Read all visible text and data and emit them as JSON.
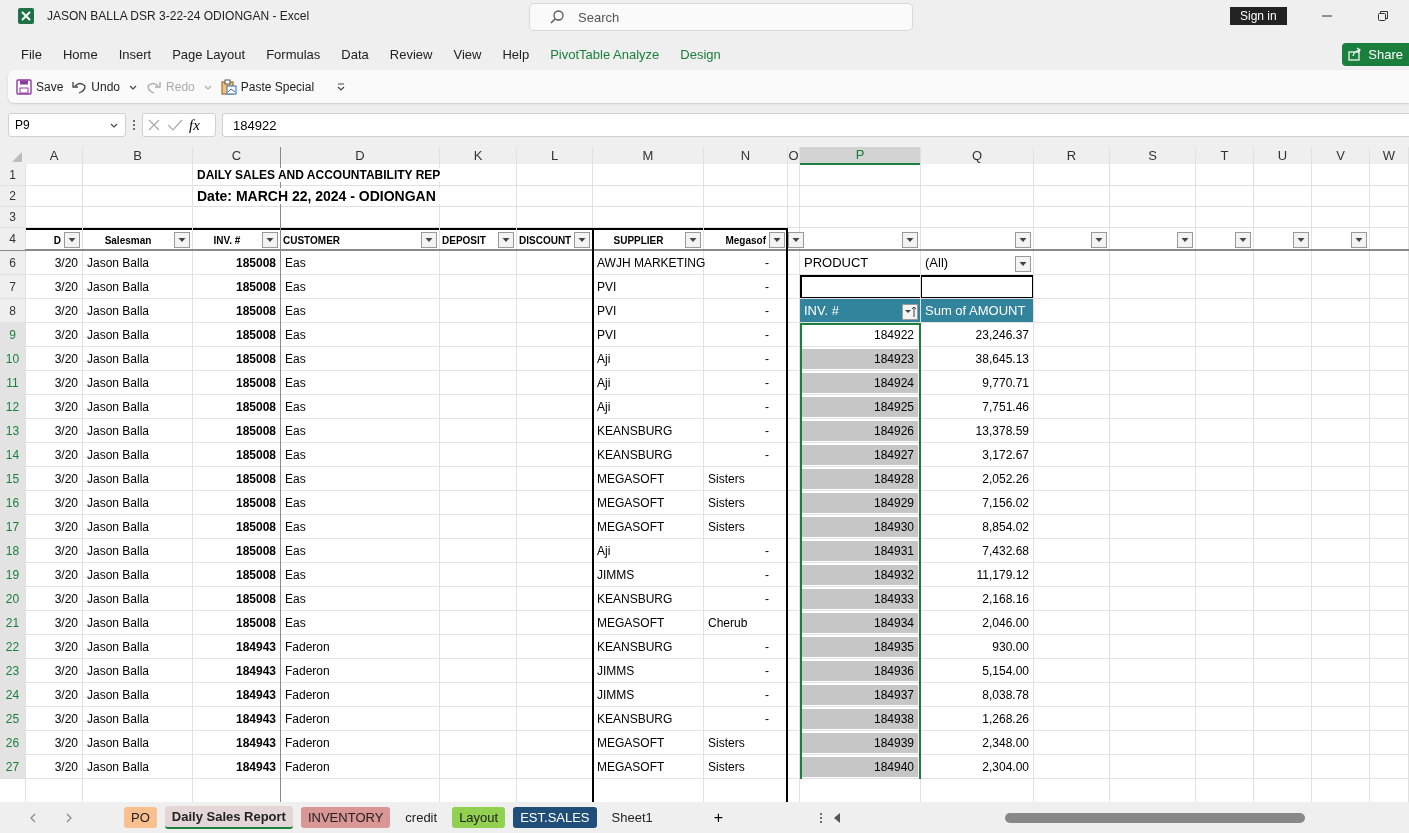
{
  "window": {
    "title": "JASON BALLA DSR 3-22-24 ODIONGAN  -  Excel",
    "search": {
      "placeholder": "Search"
    },
    "sign_in": "Sign in"
  },
  "menu": [
    {
      "label": "File",
      "kind": "standard"
    },
    {
      "label": "Home",
      "kind": "standard"
    },
    {
      "label": "Insert",
      "kind": "standard"
    },
    {
      "label": "Page Layout",
      "kind": "standard"
    },
    {
      "label": "Formulas",
      "kind": "standard"
    },
    {
      "label": "Data",
      "kind": "standard"
    },
    {
      "label": "Review",
      "kind": "standard"
    },
    {
      "label": "View",
      "kind": "standard"
    },
    {
      "label": "Help",
      "kind": "standard"
    },
    {
      "label": "PivotTable Analyze",
      "kind": "contextual"
    },
    {
      "label": "Design",
      "kind": "contextual"
    }
  ],
  "share": "Share",
  "quick_access": [
    {
      "label": "Save",
      "kind": "save",
      "disabled": false,
      "dropdown": false
    },
    {
      "label": "Undo",
      "kind": "undo",
      "disabled": false,
      "dropdown": true
    },
    {
      "label": "Redo",
      "kind": "redo",
      "disabled": true,
      "dropdown": true
    },
    {
      "label": "Paste Special",
      "kind": "paste",
      "disabled": false,
      "dropdown": false
    }
  ],
  "formula_bar": {
    "name_box": "P9",
    "fx": "fx",
    "value": "184922"
  },
  "sheet": {
    "columns": [
      {
        "letter": "A",
        "selected": false
      },
      {
        "letter": "B",
        "selected": false
      },
      {
        "letter": "C",
        "selected": false
      },
      {
        "letter": "D",
        "selected": false
      },
      {
        "letter": "K",
        "selected": false
      },
      {
        "letter": "L",
        "selected": false
      },
      {
        "letter": "M",
        "selected": false
      },
      {
        "letter": "N",
        "selected": false
      },
      {
        "letter": "O",
        "selected": false
      },
      {
        "letter": "P",
        "selected": true
      },
      {
        "letter": "Q",
        "selected": false
      },
      {
        "letter": "R",
        "selected": false
      },
      {
        "letter": "S",
        "selected": false
      },
      {
        "letter": "T",
        "selected": false
      },
      {
        "letter": "U",
        "selected": false
      },
      {
        "letter": "V",
        "selected": false
      },
      {
        "letter": "W",
        "selected": false
      }
    ],
    "rows": [
      {
        "number": "1",
        "kind": "title",
        "text": "DAILY SALES AND ACCOUNTABILITY REP"
      },
      {
        "number": "2",
        "kind": "subtitle",
        "text": "Date: MARCH 22, 2024 - ODIONGAN"
      },
      {
        "number": "3",
        "kind": "blank"
      },
      {
        "number": "4",
        "kind": "header",
        "headers": [
          {
            "label": "D",
            "filter": true
          },
          {
            "label": "Salesman",
            "filter": true
          },
          {
            "label": "INV. #",
            "filter": true
          },
          {
            "label": "CUSTOMER",
            "filter": true
          },
          {
            "label": "DEPOSIT",
            "filter": true
          },
          {
            "label": "DISCOUNT",
            "filter": true
          },
          {
            "label": "SUPPLIER",
            "filter": true
          },
          {
            "label": "Megasof",
            "filter": true
          },
          {
            "filter": true
          },
          {
            "filter": true
          },
          {
            "filter": true
          },
          {
            "filter": true
          },
          {
            "filter": true
          },
          {
            "filter": true
          },
          {
            "filter": true
          },
          {
            "filter": true
          }
        ]
      },
      {
        "number": "6",
        "kind": "data",
        "date": "3/20",
        "salesman": "Jason Balla",
        "invoice": "185008",
        "customer": "Eas",
        "supplier": "AWJH MARKETING",
        "megasoft": "-",
        "pivot": {
          "kind": "filter",
          "field": "PRODUCT",
          "value": "(All)"
        }
      },
      {
        "number": "7",
        "kind": "data",
        "date": "3/20",
        "salesman": "Jason Balla",
        "invoice": "185008",
        "customer": "Eas",
        "supplier": "PVI",
        "megasoft": "-",
        "pivot": {
          "kind": "blank"
        }
      },
      {
        "number": "8",
        "kind": "data",
        "date": "3/20",
        "salesman": "Jason Balla",
        "invoice": "185008",
        "customer": "Eas",
        "supplier": "PVI",
        "megasoft": "-",
        "pivot": {
          "kind": "header",
          "row_label": "INV. #",
          "value_label": "Sum of AMOUNT"
        }
      },
      {
        "number": "9",
        "kind": "data",
        "date": "3/20",
        "salesman": "Jason Balla",
        "invoice": "185008",
        "customer": "Eas",
        "supplier": "PVI",
        "megasoft": "-",
        "pivot": {
          "kind": "item",
          "label": "184922",
          "value": "23,246.37",
          "selected": true,
          "active": true
        }
      },
      {
        "number": "10",
        "kind": "data",
        "date": "3/20",
        "salesman": "Jason Balla",
        "invoice": "185008",
        "customer": "Eas",
        "supplier": "Aji",
        "megasoft": "-",
        "pivot": {
          "kind": "item",
          "label": "184923",
          "value": "38,645.13",
          "selected": true,
          "active": false
        }
      },
      {
        "number": "11",
        "kind": "data",
        "date": "3/20",
        "salesman": "Jason Balla",
        "invoice": "185008",
        "customer": "Eas",
        "supplier": "Aji",
        "megasoft": "-",
        "pivot": {
          "kind": "item",
          "label": "184924",
          "value": "9,770.71",
          "selected": true,
          "active": false
        }
      },
      {
        "number": "12",
        "kind": "data",
        "date": "3/20",
        "salesman": "Jason Balla",
        "invoice": "185008",
        "customer": "Eas",
        "supplier": "Aji",
        "megasoft": "-",
        "pivot": {
          "kind": "item",
          "label": "184925",
          "value": "7,751.46",
          "selected": true,
          "active": false
        }
      },
      {
        "number": "13",
        "kind": "data",
        "date": "3/20",
        "salesman": "Jason Balla",
        "invoice": "185008",
        "customer": "Eas",
        "supplier": "KEANSBURG",
        "megasoft": "-",
        "pivot": {
          "kind": "item",
          "label": "184926",
          "value": "13,378.59",
          "selected": true,
          "active": false
        }
      },
      {
        "number": "14",
        "kind": "data",
        "date": "3/20",
        "salesman": "Jason Balla",
        "invoice": "185008",
        "customer": "Eas",
        "supplier": "KEANSBURG",
        "megasoft": "-",
        "pivot": {
          "kind": "item",
          "label": "184927",
          "value": "3,172.67",
          "selected": true,
          "active": false
        }
      },
      {
        "number": "15",
        "kind": "data",
        "date": "3/20",
        "salesman": "Jason Balla",
        "invoice": "185008",
        "customer": "Eas",
        "supplier": "MEGASOFT",
        "megasoft": "Sisters",
        "pivot": {
          "kind": "item",
          "label": "184928",
          "value": "2,052.26",
          "selected": true,
          "active": false
        }
      },
      {
        "number": "16",
        "kind": "data",
        "date": "3/20",
        "salesman": "Jason Balla",
        "invoice": "185008",
        "customer": "Eas",
        "supplier": "MEGASOFT",
        "megasoft": "Sisters",
        "pivot": {
          "kind": "item",
          "label": "184929",
          "value": "7,156.02",
          "selected": true,
          "active": false
        }
      },
      {
        "number": "17",
        "kind": "data",
        "date": "3/20",
        "salesman": "Jason Balla",
        "invoice": "185008",
        "customer": "Eas",
        "supplier": "MEGASOFT",
        "megasoft": "Sisters",
        "pivot": {
          "kind": "item",
          "label": "184930",
          "value": "8,854.02",
          "selected": true,
          "active": false
        }
      },
      {
        "number": "18",
        "kind": "data",
        "date": "3/20",
        "salesman": "Jason Balla",
        "invoice": "185008",
        "customer": "Eas",
        "supplier": "Aji",
        "megasoft": "-",
        "pivot": {
          "kind": "item",
          "label": "184931",
          "value": "7,432.68",
          "selected": true,
          "active": false
        }
      },
      {
        "number": "19",
        "kind": "data",
        "date": "3/20",
        "salesman": "Jason Balla",
        "invoice": "185008",
        "customer": "Eas",
        "supplier": "JIMMS",
        "megasoft": "-",
        "pivot": {
          "kind": "item",
          "label": "184932",
          "value": "11,179.12",
          "selected": true,
          "active": false
        }
      },
      {
        "number": "20",
        "kind": "data",
        "date": "3/20",
        "salesman": "Jason Balla",
        "invoice": "185008",
        "customer": "Eas",
        "supplier": "KEANSBURG",
        "megasoft": "-",
        "pivot": {
          "kind": "item",
          "label": "184933",
          "value": "2,168.16",
          "selected": true,
          "active": false
        }
      },
      {
        "number": "21",
        "kind": "data",
        "date": "3/20",
        "salesman": "Jason Balla",
        "invoice": "185008",
        "customer": "Eas",
        "supplier": "MEGASOFT",
        "megasoft": "Cherub",
        "pivot": {
          "kind": "item",
          "label": "184934",
          "value": "2,046.00",
          "selected": true,
          "active": false
        }
      },
      {
        "number": "22",
        "kind": "data",
        "date": "3/20",
        "salesman": "Jason Balla",
        "invoice": "184943",
        "customer": "Faderon",
        "supplier": "KEANSBURG",
        "megasoft": "-",
        "pivot": {
          "kind": "item",
          "label": "184935",
          "value": "930.00",
          "selected": true,
          "active": false
        }
      },
      {
        "number": "23",
        "kind": "data",
        "date": "3/20",
        "salesman": "Jason Balla",
        "invoice": "184943",
        "customer": "Faderon",
        "supplier": "JIMMS",
        "megasoft": "-",
        "pivot": {
          "kind": "item",
          "label": "184936",
          "value": "5,154.00",
          "selected": true,
          "active": false
        }
      },
      {
        "number": "24",
        "kind": "data",
        "date": "3/20",
        "salesman": "Jason Balla",
        "invoice": "184943",
        "customer": "Faderon",
        "supplier": "JIMMS",
        "megasoft": "-",
        "pivot": {
          "kind": "item",
          "label": "184937",
          "value": "8,038.78",
          "selected": true,
          "active": false
        }
      },
      {
        "number": "25",
        "kind": "data",
        "date": "3/20",
        "salesman": "Jason Balla",
        "invoice": "184943",
        "customer": "Faderon",
        "supplier": "KEANSBURG",
        "megasoft": "-",
        "pivot": {
          "kind": "item",
          "label": "184938",
          "value": "1,268.26",
          "selected": true,
          "active": false
        }
      },
      {
        "number": "26",
        "kind": "data",
        "date": "3/20",
        "salesman": "Jason Balla",
        "invoice": "184943",
        "customer": "Faderon",
        "supplier": "MEGASOFT",
        "megasoft": "Sisters",
        "pivot": {
          "kind": "item",
          "label": "184939",
          "value": "2,348.00",
          "selected": true,
          "active": false
        }
      },
      {
        "number": "27",
        "kind": "data",
        "date": "3/20",
        "salesman": "Jason Balla",
        "invoice": "184943",
        "customer": "Faderon",
        "supplier": "MEGASOFT",
        "megasoft": "Sisters",
        "pivot": {
          "kind": "item",
          "label": "184940",
          "value": "2,304.00",
          "selected": true,
          "active": false
        }
      }
    ]
  },
  "sheet_tabs": [
    {
      "label": "PO",
      "selected": false,
      "color": "#f9bf8f"
    },
    {
      "label": "Daily Sales Report",
      "selected": true,
      "color": "#e4d6d6"
    },
    {
      "label": "INVENTORY",
      "selected": false,
      "color": "#da9694"
    },
    {
      "label": "credit",
      "selected": false
    },
    {
      "label": "Layout",
      "selected": false,
      "color": "#92d050"
    },
    {
      "label": "EST.SALES",
      "selected": false,
      "color": "#1f4e79"
    },
    {
      "label": "Sheet1",
      "selected": false
    }
  ],
  "add_sheet": "+"
}
